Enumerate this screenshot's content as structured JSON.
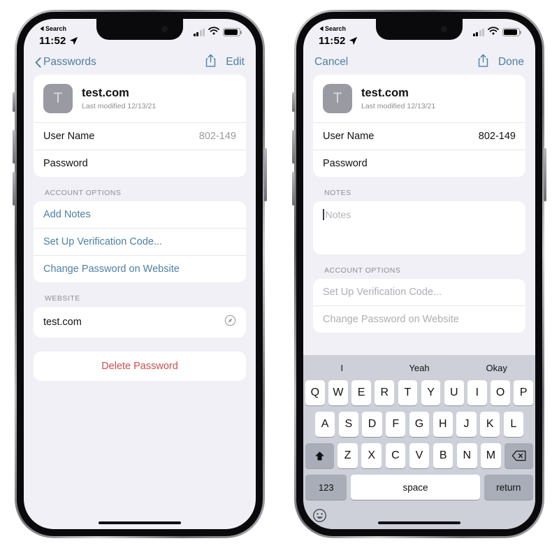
{
  "status_bar": {
    "time": "11:52",
    "back_label": "Search",
    "location_icon": "location-arrow-icon",
    "cellular_icon": "cellular-bars-icon",
    "cellular_bars_filled": 2,
    "wifi_icon": "wifi-icon",
    "battery_icon": "battery-icon"
  },
  "phone_left": {
    "nav": {
      "back_label": "Passwords",
      "back_icon": "chevron-left-icon",
      "share_icon": "share-icon",
      "action_label": "Edit"
    },
    "account_card": {
      "avatar_letter": "T",
      "title": "test.com",
      "subtitle": "Last modified 12/13/21",
      "rows": [
        {
          "label": "User Name",
          "value": "802-149"
        },
        {
          "label": "Password",
          "value": ""
        }
      ]
    },
    "account_options": {
      "header": "ACCOUNT OPTIONS",
      "items": [
        "Add Notes",
        "Set Up Verification Code...",
        "Change Password on Website"
      ]
    },
    "website": {
      "header": "WEBSITE",
      "value": "test.com",
      "open_icon": "safari-compass-icon"
    },
    "delete_label": "Delete Password"
  },
  "phone_right": {
    "nav": {
      "cancel_label": "Cancel",
      "share_icon": "share-icon",
      "action_label": "Done"
    },
    "account_card": {
      "avatar_letter": "T",
      "title": "test.com",
      "subtitle": "Last modified 12/13/21",
      "rows": [
        {
          "label": "User Name",
          "value": "802-149"
        },
        {
          "label": "Password",
          "value": ""
        }
      ]
    },
    "notes": {
      "header": "NOTES",
      "placeholder": "Notes",
      "value": ""
    },
    "account_options": {
      "header": "ACCOUNT OPTIONS",
      "items": [
        "Set Up Verification Code...",
        "Change Password on Website"
      ]
    },
    "keyboard": {
      "predictions": [
        "I",
        "Yeah",
        "Okay"
      ],
      "row1": [
        "Q",
        "W",
        "E",
        "R",
        "T",
        "Y",
        "U",
        "I",
        "O",
        "P"
      ],
      "row2": [
        "A",
        "S",
        "D",
        "F",
        "G",
        "H",
        "J",
        "K",
        "L"
      ],
      "row3": [
        "Z",
        "X",
        "C",
        "V",
        "B",
        "N",
        "M"
      ],
      "shift_icon": "shift-arrow-icon",
      "backspace_icon": "backspace-icon",
      "numbers_label": "123",
      "space_label": "space",
      "return_label": "return",
      "emoji_icon": "emoji-smiley-icon"
    }
  },
  "colors": {
    "accent_blue": "#4e7fa3",
    "destructive_red": "#c8514e",
    "screen_bg": "#f1f0f6",
    "card_bg": "#ffffff",
    "muted_text": "#8d8d93",
    "disabled_text": "#aeaeb4",
    "keyboard_bg": "#cdd0d8"
  }
}
